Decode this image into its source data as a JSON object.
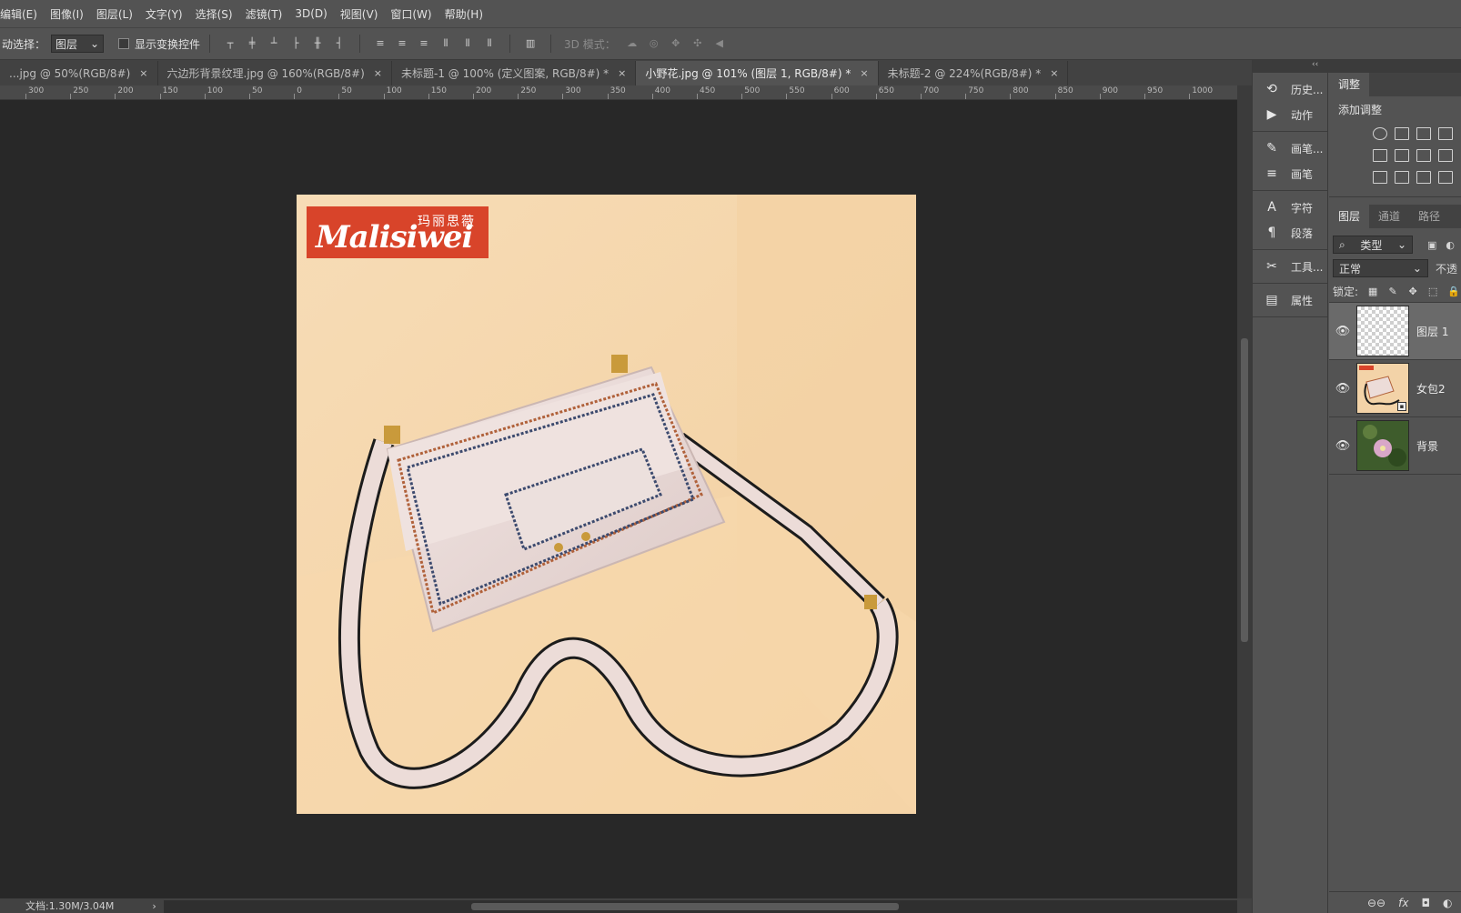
{
  "menubar": {
    "items": [
      "编辑(E)",
      "图像(I)",
      "图层(L)",
      "文字(Y)",
      "选择(S)",
      "滤镜(T)",
      "3D(D)",
      "视图(V)",
      "窗口(W)",
      "帮助(H)"
    ]
  },
  "options": {
    "auto_select_label": "动选择：",
    "auto_select_value": "图层",
    "show_transform_label": "显示变换控件",
    "mode3d_label": "3D 模式："
  },
  "tabs": [
    {
      "label": "...jpg @ 50%(RGB/8#)",
      "close": "×"
    },
    {
      "label": "六边形背景纹理.jpg @ 160%(RGB/8#)",
      "close": "×"
    },
    {
      "label": "未标题-1 @ 100% (定义图案, RGB/8#) *",
      "close": "×"
    },
    {
      "label": "小野花.jpg @ 101% (图层 1, RGB/8#) *",
      "close": "×"
    },
    {
      "label": "未标题-2 @ 224%(RGB/8#) *",
      "close": "×"
    }
  ],
  "ruler": {
    "labels": [
      "300",
      "250",
      "200",
      "150",
      "100",
      "50",
      "0",
      "50",
      "100",
      "150",
      "200",
      "250",
      "300",
      "350",
      "400",
      "450",
      "500",
      "550",
      "600",
      "650",
      "700",
      "750",
      "800",
      "850",
      "900",
      "950",
      "1000"
    ]
  },
  "document": {
    "logo_en": "Malisiwei",
    "logo_cn": "玛丽思薇"
  },
  "status": {
    "doc_size": "文档:1.30M/3.04M",
    "arrow": "›"
  },
  "dock": {
    "collapse": "‹‹",
    "groups": [
      [
        {
          "icon": "history-icon",
          "glyph": "⟲",
          "label": "历史..."
        },
        {
          "icon": "actions-icon",
          "glyph": "▶",
          "label": "动作"
        }
      ],
      [
        {
          "icon": "brush-icon",
          "glyph": "✎",
          "label": "画笔..."
        },
        {
          "icon": "brush-settings-icon",
          "glyph": "≡",
          "label": "画笔"
        }
      ],
      [
        {
          "icon": "character-icon",
          "glyph": "A",
          "label": "字符"
        },
        {
          "icon": "paragraph-icon",
          "glyph": "¶",
          "label": "段落"
        }
      ],
      [
        {
          "icon": "tool-presets-icon",
          "glyph": "✂",
          "label": "工具..."
        }
      ],
      [
        {
          "icon": "properties-icon",
          "glyph": "▤",
          "label": "属性"
        }
      ]
    ]
  },
  "adjustments": {
    "tab": "调整",
    "title": "添加调整"
  },
  "layers": {
    "tabs": [
      "图层",
      "通道",
      "路径"
    ],
    "filter_label": "类型",
    "blend_mode": "正常",
    "opacity_label": "不透",
    "lock_label": "锁定:",
    "items": [
      {
        "name": "图层 1",
        "thumb": "transparent",
        "selected": true
      },
      {
        "name": "女包2",
        "thumb": "bag",
        "selected": false
      },
      {
        "name": "背景",
        "thumb": "flower",
        "selected": false
      }
    ],
    "footer": [
      "⊖⊖",
      "fx",
      "◘",
      "◐"
    ]
  }
}
